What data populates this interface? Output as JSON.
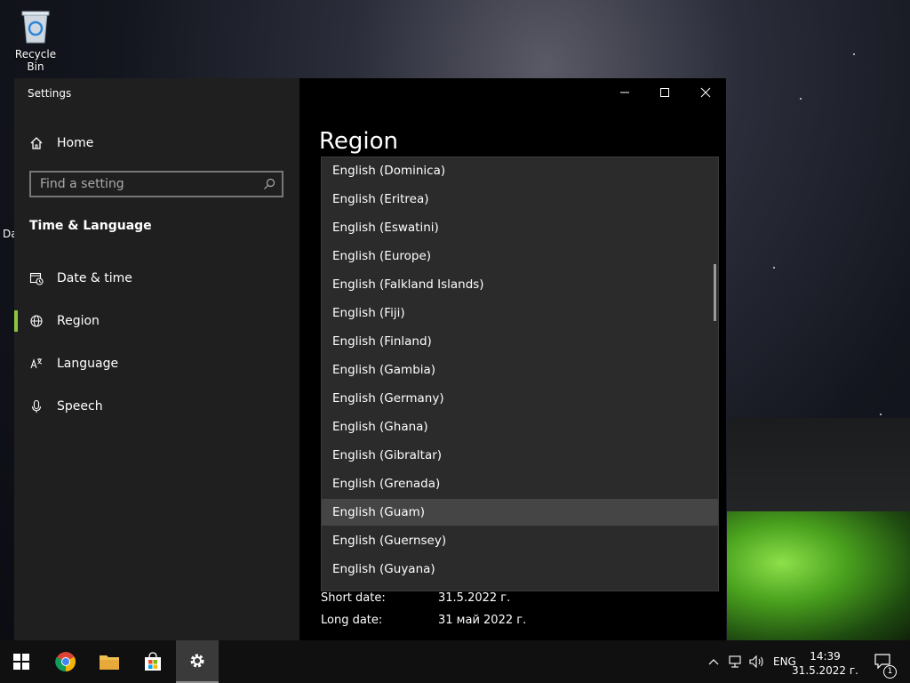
{
  "desktop": {
    "recycle_bin_label": "Recycle Bin",
    "partial_label": "Da"
  },
  "window": {
    "title": "Settings",
    "home_label": "Home",
    "search_placeholder": "Find a setting",
    "section_title": "Time & Language",
    "nav_items": [
      {
        "label": "Date & time",
        "icon": "calendar-clock-icon"
      },
      {
        "label": "Region",
        "icon": "globe-icon",
        "selected": true
      },
      {
        "label": "Language",
        "icon": "language-icon"
      },
      {
        "label": "Speech",
        "icon": "microphone-icon"
      }
    ],
    "accent_color": "#8dc63f"
  },
  "main": {
    "page_title": "Region",
    "dropdown": {
      "items": [
        "English (Dominica)",
        "English (Eritrea)",
        "English (Eswatini)",
        "English (Europe)",
        "English (Falkland Islands)",
        "English (Fiji)",
        "English (Finland)",
        "English (Gambia)",
        "English (Germany)",
        "English (Ghana)",
        "English (Gibraltar)",
        "English (Grenada)",
        "English (Guam)",
        "English (Guernsey)",
        "English (Guyana)"
      ],
      "hovered": "English (Guam)"
    },
    "format_rows": [
      {
        "key": "Short date:",
        "value": "31.5.2022 г."
      },
      {
        "key": "Long date:",
        "value": "31 май 2022 г."
      }
    ]
  },
  "taskbar": {
    "language": "ENG",
    "time": "14:39",
    "date": "31.5.2022 г.",
    "notification_count": "1"
  }
}
